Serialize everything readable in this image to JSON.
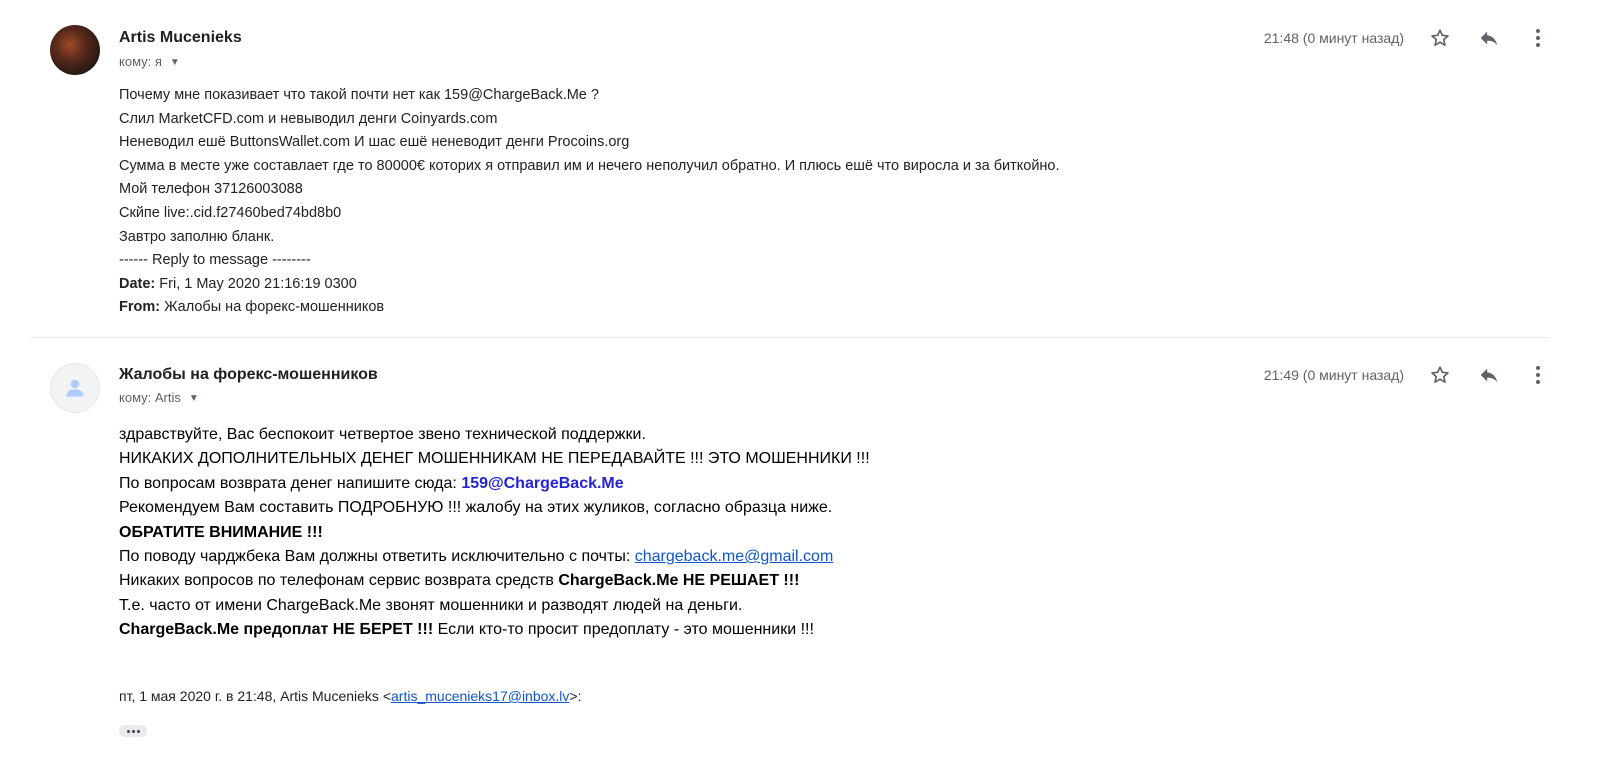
{
  "messages": [
    {
      "sender": "Artis Mucenieks",
      "recipient": "кому: я",
      "time": "21:48 (0 минут назад)",
      "body_lines": [
        "Почему мне показивает что такой почти нет как 159@ChargeBack.Me ?",
        "Слил MarketCFD.com и невыводил денги Coinyards.com",
        "Неневодил ешё ButtonsWallet.com И шас ешё неневодит денги Procoins.org",
        "Сумма в месте уже составлает где то 80000€ которих я отправил им и нечего неполучил обратно. И плюсь ешё что виросла и за биткойно.",
        "Мой телефон 37126003088",
        "Скйпе live:.cid.f27460bed74bd8b0",
        "Завтро заполню бланк.",
        "------ Reply to message --------"
      ],
      "date_label": "Date:",
      "date_value": "Fri, 1 May 2020 21:16:19 0300",
      "from_label": "From:",
      "from_value": "Жалобы на форекс-мошенников"
    },
    {
      "sender": "Жалобы на форекс-мошенников",
      "recipient": "кому: Artis",
      "time": "21:49 (0 минут назад)",
      "lines": {
        "l1": "здравствуйте, Вас беспокоит четвертое звено технической поддержки.",
        "l2": "НИКАКИХ ДОПОЛНИТЕЛЬНЫХ ДЕНЕГ МОШЕННИКАМ НЕ ПЕРЕДАВАЙТЕ !!! ЭТО МОШЕННИКИ !!!",
        "l3_prefix": "По вопросам возврата денег напишите сюда: ",
        "l3_email": "159@ChargeBack.Me",
        "l4": "Рекомендуем Вам составить ПОДРОБНУЮ !!! жалобу на этих жуликов, согласно образца ниже.",
        "l5": "ОБРАТИТЕ ВНИМАНИЕ !!!",
        "l6_prefix": "По поводу чарджбека Вам должны ответить исключительно с почты: ",
        "l6_link": "chargeback.me@gmail.com",
        "l7_prefix": "Никаких вопросов по телефонам сервис возврата средств ",
        "l7_bold": "ChargeBack.Me НЕ РЕШАЕТ !!!",
        "l8": "Т.е. часто от имени ChargeBack.Me звонят мошенники и разводят людей на деньги.",
        "l9_bold": "ChargeBack.Me предоплат НЕ БЕРЕТ !!!",
        "l9_suffix": " Если кто-то просит предоплату - это мошенники !!!"
      },
      "quote_prefix": "пт, 1 мая 2020 г. в 21:48, Artis Mucenieks <",
      "quote_email": "artis_mucenieks17@inbox.lv",
      "quote_suffix": ">:"
    }
  ],
  "icons": {
    "star": "star-icon",
    "reply": "reply-icon",
    "more": "more-vert-icon",
    "avatar_default": "person-icon",
    "caret": "caret-down-icon",
    "ellipsis": "show-trimmed-content-icon"
  },
  "colors": {
    "link": "#1155cc",
    "bold_email": "#2424d6",
    "muted": "#5f6368"
  }
}
